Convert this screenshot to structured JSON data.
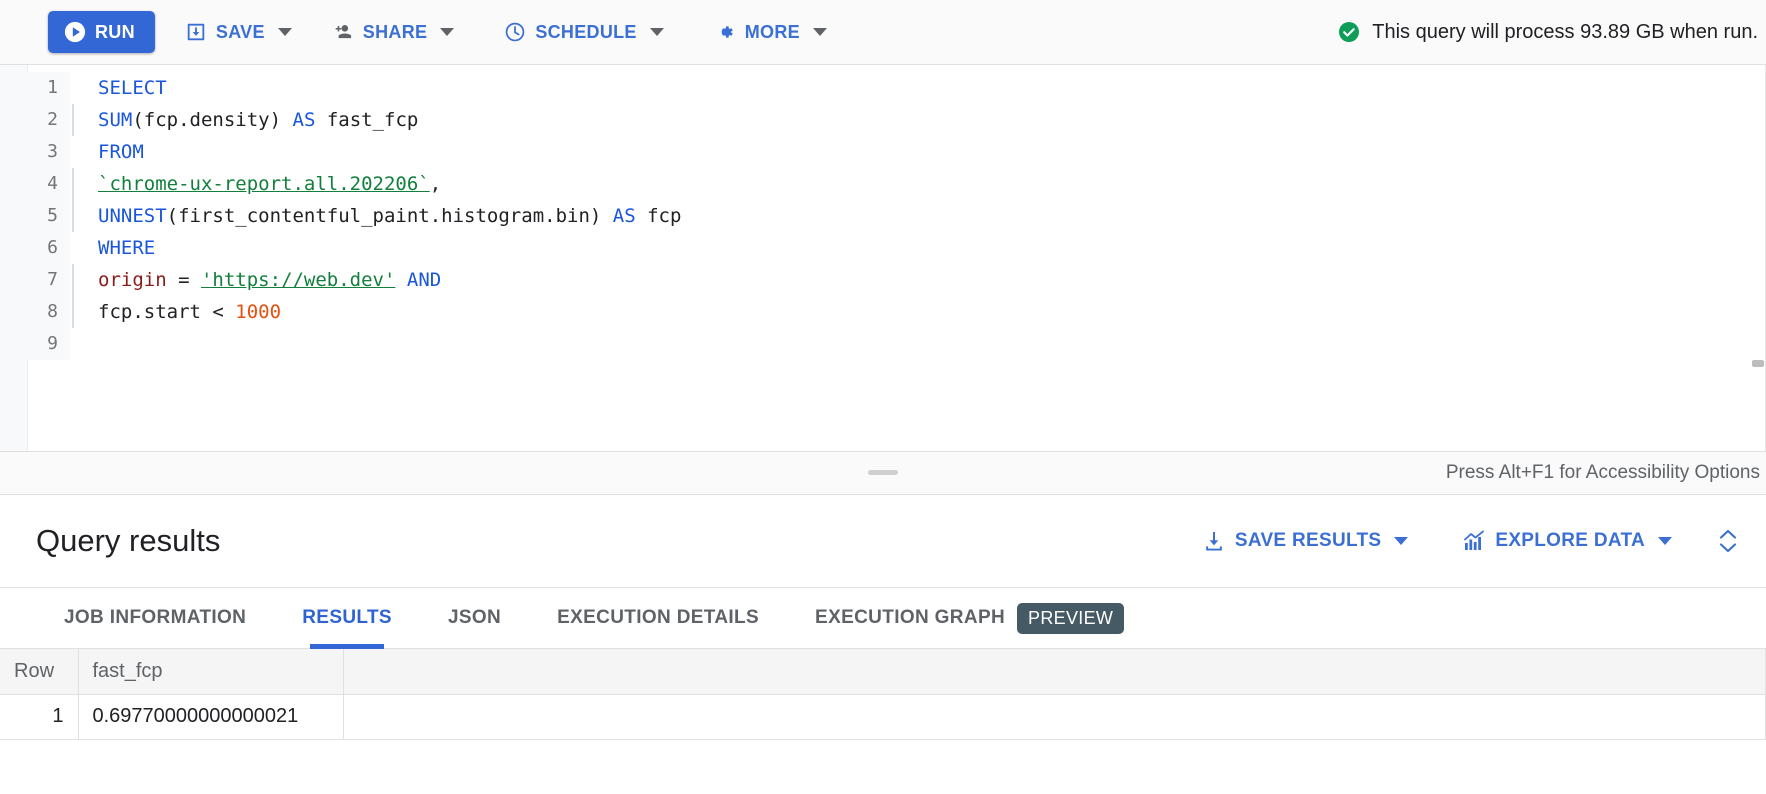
{
  "toolbar": {
    "run_label": "RUN",
    "save_label": "SAVE",
    "share_label": "SHARE",
    "schedule_label": "SCHEDULE",
    "more_label": "MORE",
    "status_message": "This query will process 93.89 GB when run.",
    "status_color": "#0f9d58",
    "run_button_color": "#3367d6",
    "link_color": "#3b6fd4",
    "icons": {
      "run": "play-circle-icon",
      "save": "save-download-icon",
      "share": "person-add-icon",
      "schedule": "clock-icon",
      "more": "gear-icon",
      "status": "check-circle-icon"
    }
  },
  "editor": {
    "line_numbers": [
      "1",
      "2",
      "3",
      "4",
      "5",
      "6",
      "7",
      "8",
      "9"
    ],
    "lines": [
      {
        "n": "1",
        "indent": false,
        "tokens": [
          {
            "t": "SELECT",
            "c": "kw"
          }
        ]
      },
      {
        "n": "2",
        "indent": true,
        "tokens": [
          {
            "t": "SUM",
            "c": "fn"
          },
          {
            "t": "(fcp.density)",
            "c": "plain"
          },
          {
            "t": " ",
            "c": "plain"
          },
          {
            "t": "AS",
            "c": "kw"
          },
          {
            "t": " fast_fcp",
            "c": "plain"
          }
        ]
      },
      {
        "n": "3",
        "indent": false,
        "tokens": [
          {
            "t": "FROM",
            "c": "kw"
          }
        ]
      },
      {
        "n": "4",
        "indent": true,
        "tokens": [
          {
            "t": "`chrome-ux-report.all.202206`",
            "c": "bt"
          },
          {
            "t": ",",
            "c": "plain"
          }
        ]
      },
      {
        "n": "5",
        "indent": true,
        "tokens": [
          {
            "t": "UNNEST",
            "c": "fn"
          },
          {
            "t": "(first_contentful_paint.histogram.bin)",
            "c": "plain"
          },
          {
            "t": " ",
            "c": "plain"
          },
          {
            "t": "AS",
            "c": "kw"
          },
          {
            "t": " fcp",
            "c": "plain"
          }
        ]
      },
      {
        "n": "6",
        "indent": false,
        "tokens": [
          {
            "t": "WHERE",
            "c": "kw"
          }
        ]
      },
      {
        "n": "7",
        "indent": true,
        "tokens": [
          {
            "t": "origin",
            "c": "ident"
          },
          {
            "t": " = ",
            "c": "plain"
          },
          {
            "t": "'https://web.dev'",
            "c": "str"
          },
          {
            "t": " ",
            "c": "plain"
          },
          {
            "t": "AND",
            "c": "kw"
          }
        ]
      },
      {
        "n": "8",
        "indent": true,
        "tokens": [
          {
            "t": "fcp.start",
            "c": "plain"
          },
          {
            "t": " < ",
            "c": "plain"
          },
          {
            "t": "1000",
            "c": "num"
          }
        ]
      },
      {
        "n": "9",
        "indent": false,
        "tokens": []
      }
    ],
    "raw_query": "SELECT\n  SUM(fcp.density) AS fast_fcp\nFROM\n  `chrome-ux-report.all.202206`,\n  UNNEST(first_contentful_paint.histogram.bin) AS fcp\nWHERE\n  origin = 'https://web.dev' AND\n  fcp.start < 1000\n",
    "accessibility_note": "Press Alt+F1 for Accessibility Options",
    "syntax_colors": {
      "keyword": "#1a56db",
      "string": "#12803c",
      "identifier": "#8b1a1a",
      "number": "#e8500f",
      "plain": "#202124"
    }
  },
  "results": {
    "title": "Query results",
    "save_results_label": "SAVE RESULTS",
    "explore_data_label": "EXPLORE DATA",
    "icons": {
      "save_results": "download-icon",
      "explore_data": "chart-trend-icon",
      "expand": "expand-collapse-icon"
    },
    "tabs": [
      {
        "label": "JOB INFORMATION",
        "active": false,
        "badge": null
      },
      {
        "label": "RESULTS",
        "active": true,
        "badge": null
      },
      {
        "label": "JSON",
        "active": false,
        "badge": null
      },
      {
        "label": "EXECUTION DETAILS",
        "active": false,
        "badge": null
      },
      {
        "label": "EXECUTION GRAPH",
        "active": false,
        "badge": "PREVIEW"
      }
    ],
    "active_tab_color": "#3367d6",
    "badge_color": "#455a64",
    "table": {
      "columns": [
        "Row",
        "fast_fcp",
        ""
      ],
      "rows": [
        {
          "row": "1",
          "fast_fcp": "0.69770000000000021",
          "extra": ""
        }
      ]
    }
  }
}
